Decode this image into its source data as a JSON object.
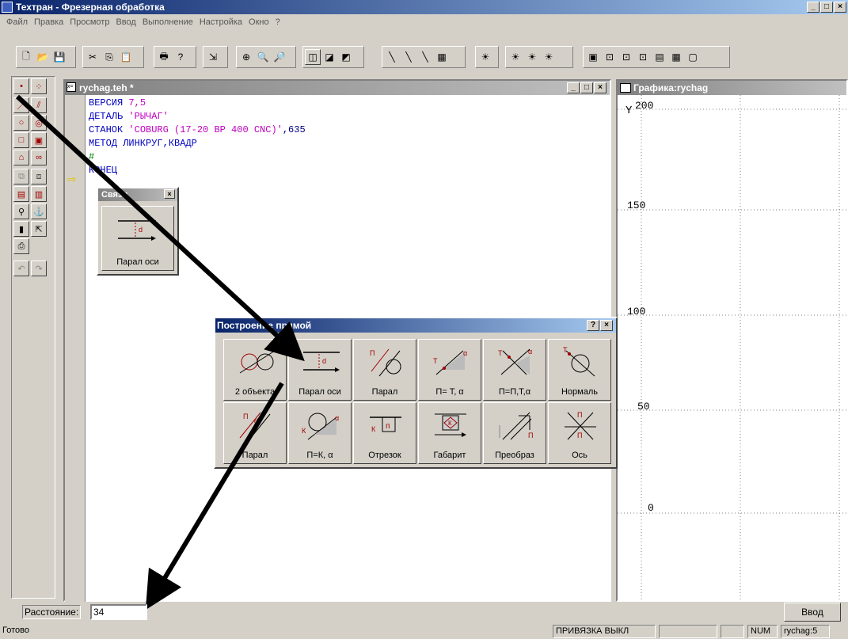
{
  "app": {
    "title": "Техтран - Фрезерная обработка"
  },
  "menu": [
    "Файл",
    "Правка",
    "Просмотр",
    "Ввод",
    "Выполнение",
    "Настройка",
    "Окно",
    "?"
  ],
  "editor": {
    "title": "rychag.teh *",
    "lines": [
      {
        "parts": [
          {
            "t": "ВЕРСИЯ ",
            "c": "kw"
          },
          {
            "t": "7,5",
            "c": "str"
          }
        ]
      },
      {
        "parts": [
          {
            "t": "ДЕТАЛЬ ",
            "c": "kw"
          },
          {
            "t": "'РЫЧАГ'",
            "c": "str"
          }
        ]
      },
      {
        "parts": [
          {
            "t": "СТАНОК ",
            "c": "kw"
          },
          {
            "t": "'COBURG (17-20 BP 400 CNC)'",
            "c": "str"
          },
          {
            "t": ",635",
            "c": "num"
          }
        ]
      },
      {
        "parts": [
          {
            "t": "МЕТОД ЛИНКРУГ,КВАДР",
            "c": "kw"
          }
        ]
      },
      {
        "parts": [
          {
            "t": "#",
            "c": "cmt"
          }
        ]
      },
      {
        "parts": [
          {
            "t": "КОНЕЦ",
            "c": "kw"
          }
        ]
      }
    ]
  },
  "graphics": {
    "title": "Графика:rychag",
    "axis_label": "Y",
    "ticks": [
      "200",
      "150",
      "100",
      "50",
      "0"
    ]
  },
  "small_palette": {
    "title": "Связи",
    "button_label": "Парал оси"
  },
  "palette": {
    "title": "Построение прямой",
    "buttons": [
      {
        "label": "2 объекта",
        "icon": "two-objects-icon"
      },
      {
        "label": "Парал оси",
        "icon": "parallel-axis-icon"
      },
      {
        "label": "Парал",
        "icon": "parallel-icon"
      },
      {
        "label": "П= Т, α",
        "icon": "point-angle-icon"
      },
      {
        "label": "П=П,Т,α",
        "icon": "line-point-angle-icon"
      },
      {
        "label": "Нормаль",
        "icon": "normal-icon"
      },
      {
        "label": "Парал",
        "icon": "parallel-distance-icon"
      },
      {
        "label": "П=К, α",
        "icon": "circle-angle-icon"
      },
      {
        "label": "Отрезок",
        "icon": "segment-icon"
      },
      {
        "label": "Габарит",
        "icon": "bounds-icon"
      },
      {
        "label": "Преобраз",
        "icon": "transform-icon"
      },
      {
        "label": "Ось",
        "icon": "axis-icon"
      }
    ]
  },
  "prompt": {
    "label": "Расстояние:",
    "value": "34",
    "enter_label": "Ввод"
  },
  "status": {
    "ready": "Готово",
    "snap": "ПРИВЯЗКА ВЫКЛ",
    "num": "NUM",
    "file": "rychag:5"
  }
}
